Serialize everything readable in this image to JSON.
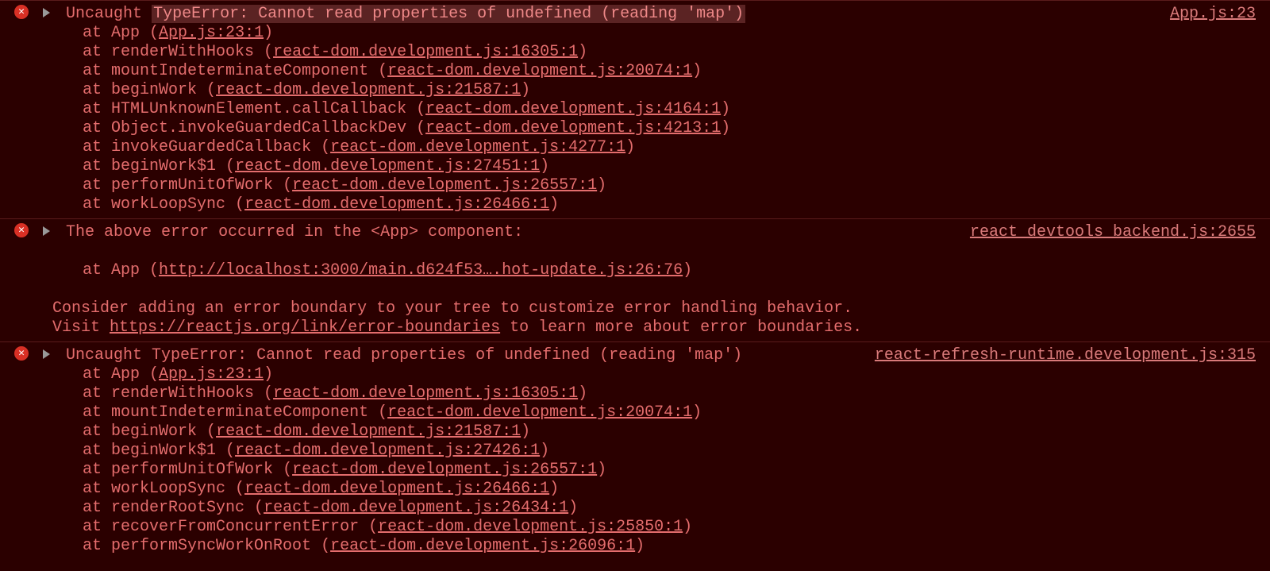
{
  "entries": [
    {
      "source": "App.js:23",
      "header_prefix": "Uncaught ",
      "header_highlight": "TypeError: Cannot read properties of undefined (reading 'map')",
      "frames": [
        {
          "fn": "App",
          "loc": "App.js:23:1"
        },
        {
          "fn": "renderWithHooks",
          "loc": "react-dom.development.js:16305:1"
        },
        {
          "fn": "mountIndeterminateComponent",
          "loc": "react-dom.development.js:20074:1"
        },
        {
          "fn": "beginWork",
          "loc": "react-dom.development.js:21587:1"
        },
        {
          "fn": "HTMLUnknownElement.callCallback",
          "loc": "react-dom.development.js:4164:1"
        },
        {
          "fn": "Object.invokeGuardedCallbackDev",
          "loc": "react-dom.development.js:4213:1"
        },
        {
          "fn": "invokeGuardedCallback",
          "loc": "react-dom.development.js:4277:1"
        },
        {
          "fn": "beginWork$1",
          "loc": "react-dom.development.js:27451:1"
        },
        {
          "fn": "performUnitOfWork",
          "loc": "react-dom.development.js:26557:1"
        },
        {
          "fn": "workLoopSync",
          "loc": "react-dom.development.js:26466:1"
        }
      ]
    },
    {
      "source": "react_devtools_backend.js:2655",
      "header_plain": "The above error occurred in the <App> component:",
      "frames": [
        {
          "fn": "App",
          "loc": "http://localhost:3000/main.d624f53….hot-update.js:26:76"
        }
      ],
      "footer": {
        "line1": "Consider adding an error boundary to your tree to customize error handling behavior.",
        "line2_prefix": "Visit ",
        "line2_link": "https://reactjs.org/link/error-boundaries",
        "line2_suffix": " to learn more about error boundaries."
      }
    },
    {
      "source": "react-refresh-runtime.development.js:315",
      "header_plain": "Uncaught TypeError: Cannot read properties of undefined (reading 'map')",
      "frames": [
        {
          "fn": "App",
          "loc": "App.js:23:1"
        },
        {
          "fn": "renderWithHooks",
          "loc": "react-dom.development.js:16305:1"
        },
        {
          "fn": "mountIndeterminateComponent",
          "loc": "react-dom.development.js:20074:1"
        },
        {
          "fn": "beginWork",
          "loc": "react-dom.development.js:21587:1"
        },
        {
          "fn": "beginWork$1",
          "loc": "react-dom.development.js:27426:1"
        },
        {
          "fn": "performUnitOfWork",
          "loc": "react-dom.development.js:26557:1"
        },
        {
          "fn": "workLoopSync",
          "loc": "react-dom.development.js:26466:1"
        },
        {
          "fn": "renderRootSync",
          "loc": "react-dom.development.js:26434:1"
        },
        {
          "fn": "recoverFromConcurrentError",
          "loc": "react-dom.development.js:25850:1"
        },
        {
          "fn": "performSyncWorkOnRoot",
          "loc": "react-dom.development.js:26096:1"
        }
      ]
    }
  ]
}
